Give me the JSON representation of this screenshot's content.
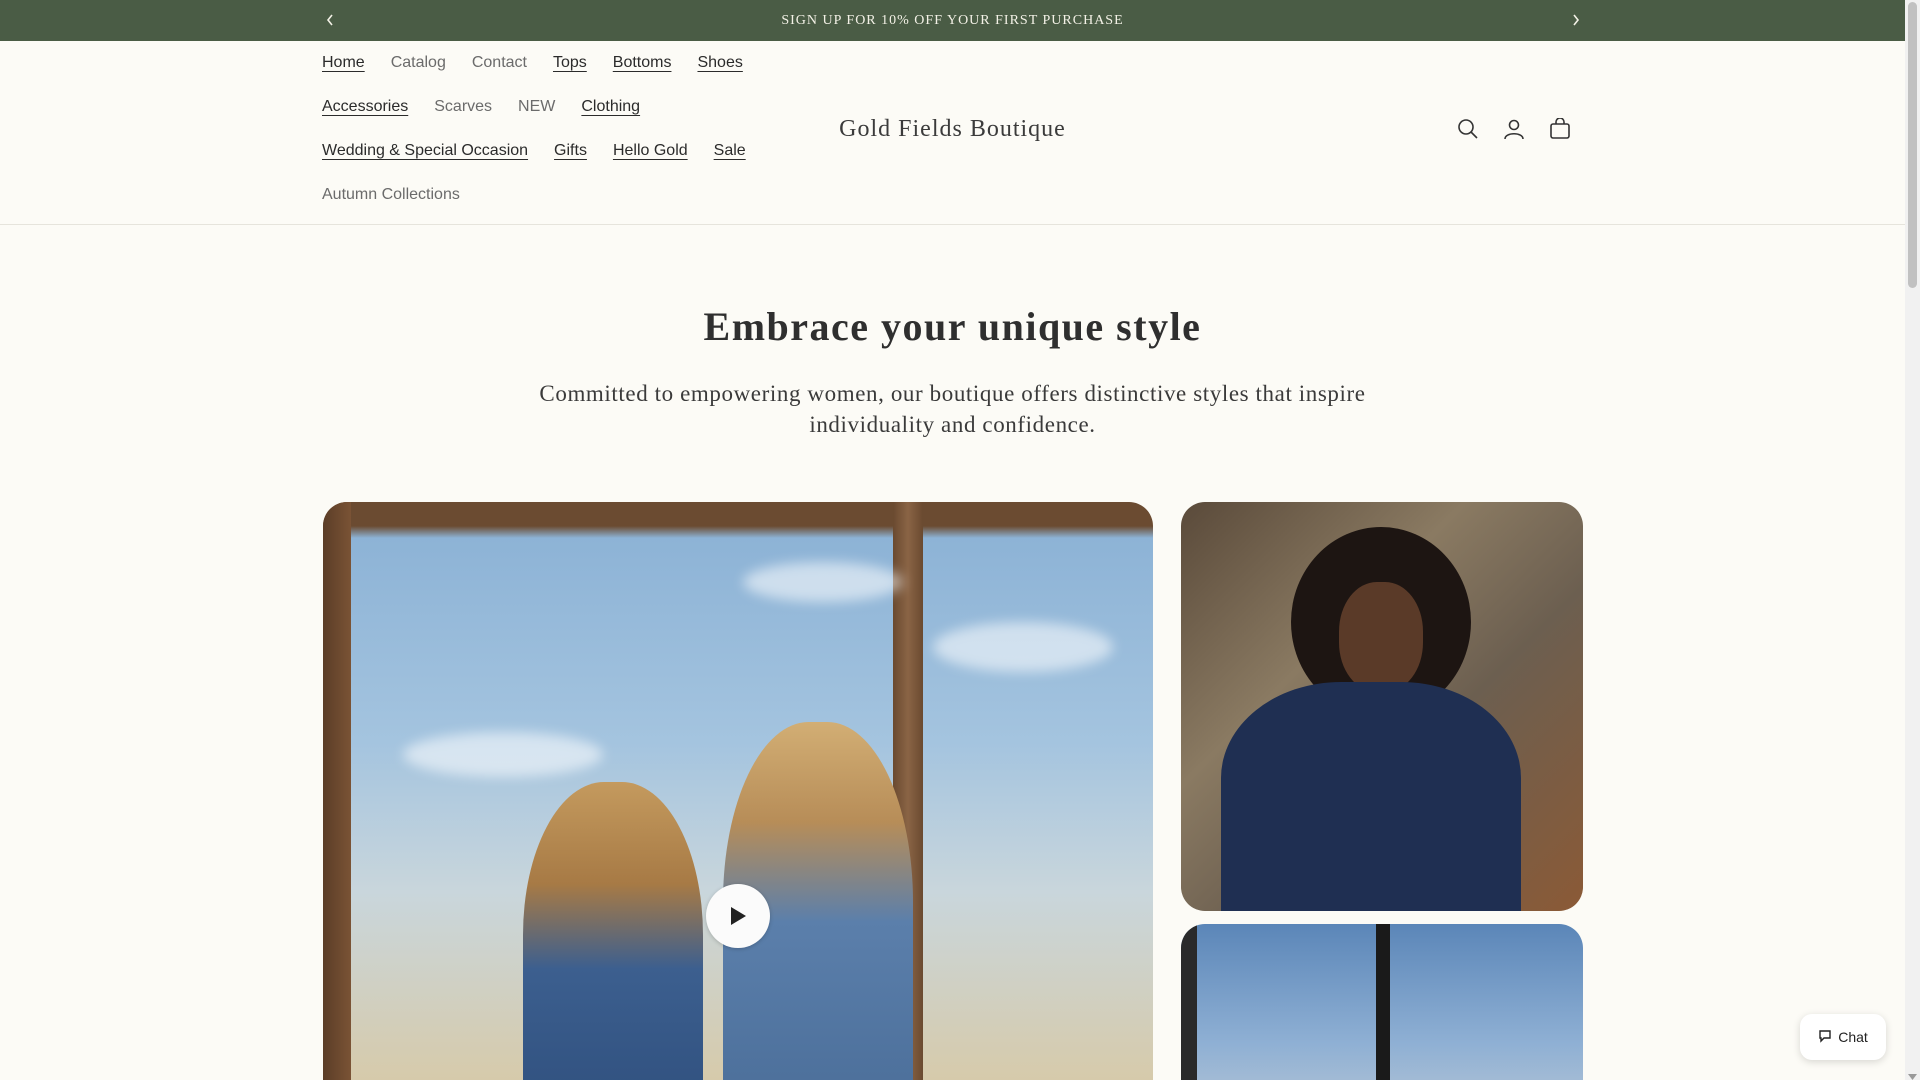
{
  "announcement": {
    "message": "SIGN UP FOR 10% OFF YOUR FIRST PURCHASE",
    "prev_icon": "chevron-left-icon",
    "next_icon": "chevron-right-icon"
  },
  "nav": {
    "rows": [
      [
        {
          "label": "Home",
          "underlined": true
        },
        {
          "label": "Catalog",
          "underlined": false
        },
        {
          "label": "Contact",
          "underlined": false
        },
        {
          "label": "Tops",
          "underlined": true
        },
        {
          "label": "Bottoms",
          "underlined": true
        },
        {
          "label": "Shoes",
          "underlined": true
        }
      ],
      [
        {
          "label": "Accessories",
          "underlined": true
        },
        {
          "label": "Scarves",
          "underlined": false
        },
        {
          "label": "NEW",
          "underlined": false
        },
        {
          "label": "Clothing",
          "underlined": true
        }
      ],
      [
        {
          "label": "Wedding & Special Occasion",
          "underlined": true
        },
        {
          "label": "Gifts",
          "underlined": true
        },
        {
          "label": "Hello Gold",
          "underlined": true
        },
        {
          "label": "Sale",
          "underlined": true
        }
      ],
      [
        {
          "label": "Autumn Collections",
          "underlined": false
        }
      ]
    ]
  },
  "brand": {
    "name": "Gold Fields Boutique"
  },
  "header_icons": [
    "search-icon",
    "account-icon",
    "cart-icon"
  ],
  "hero": {
    "title": "Embrace your unique style",
    "subtitle": "Committed to empowering women, our boutique offers distinctive styles that inspire individuality and confidence."
  },
  "chat": {
    "label": "Chat"
  },
  "colors": {
    "announcement_bg": "#4a5c45",
    "page_bg": "#fcfbf6",
    "text": "#2b2b2b"
  }
}
